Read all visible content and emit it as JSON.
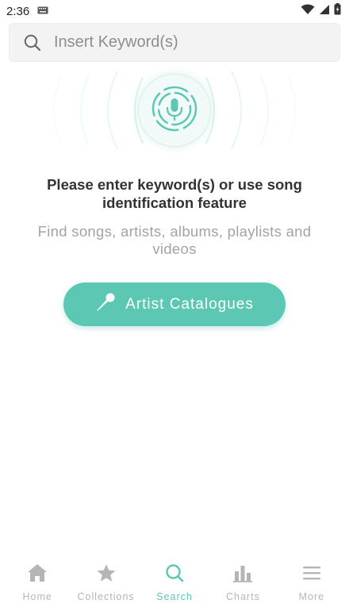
{
  "status_bar": {
    "time": "2:36"
  },
  "search": {
    "placeholder": "Insert Keyword(s)",
    "value": ""
  },
  "prompt": {
    "title": "Please enter keyword(s) or use song identification feature",
    "subtitle": "Find songs, artists, albums, playlists and videos"
  },
  "artist_button": {
    "label": "Artist Catalogues"
  },
  "bottom_nav": {
    "items": [
      {
        "label": "Home",
        "icon": "home-icon",
        "active": false
      },
      {
        "label": "Collections",
        "icon": "star-icon",
        "active": false
      },
      {
        "label": "Search",
        "icon": "search-icon",
        "active": true
      },
      {
        "label": "Charts",
        "icon": "bar-chart-icon",
        "active": false
      },
      {
        "label": "More",
        "icon": "menu-icon",
        "active": false
      }
    ]
  },
  "colors": {
    "accent": "#5cc7b3",
    "inactive": "#b5b5b5",
    "title_text": "#333333",
    "subtitle_text": "#a3a3a3",
    "search_bg": "#f3f3f3"
  }
}
